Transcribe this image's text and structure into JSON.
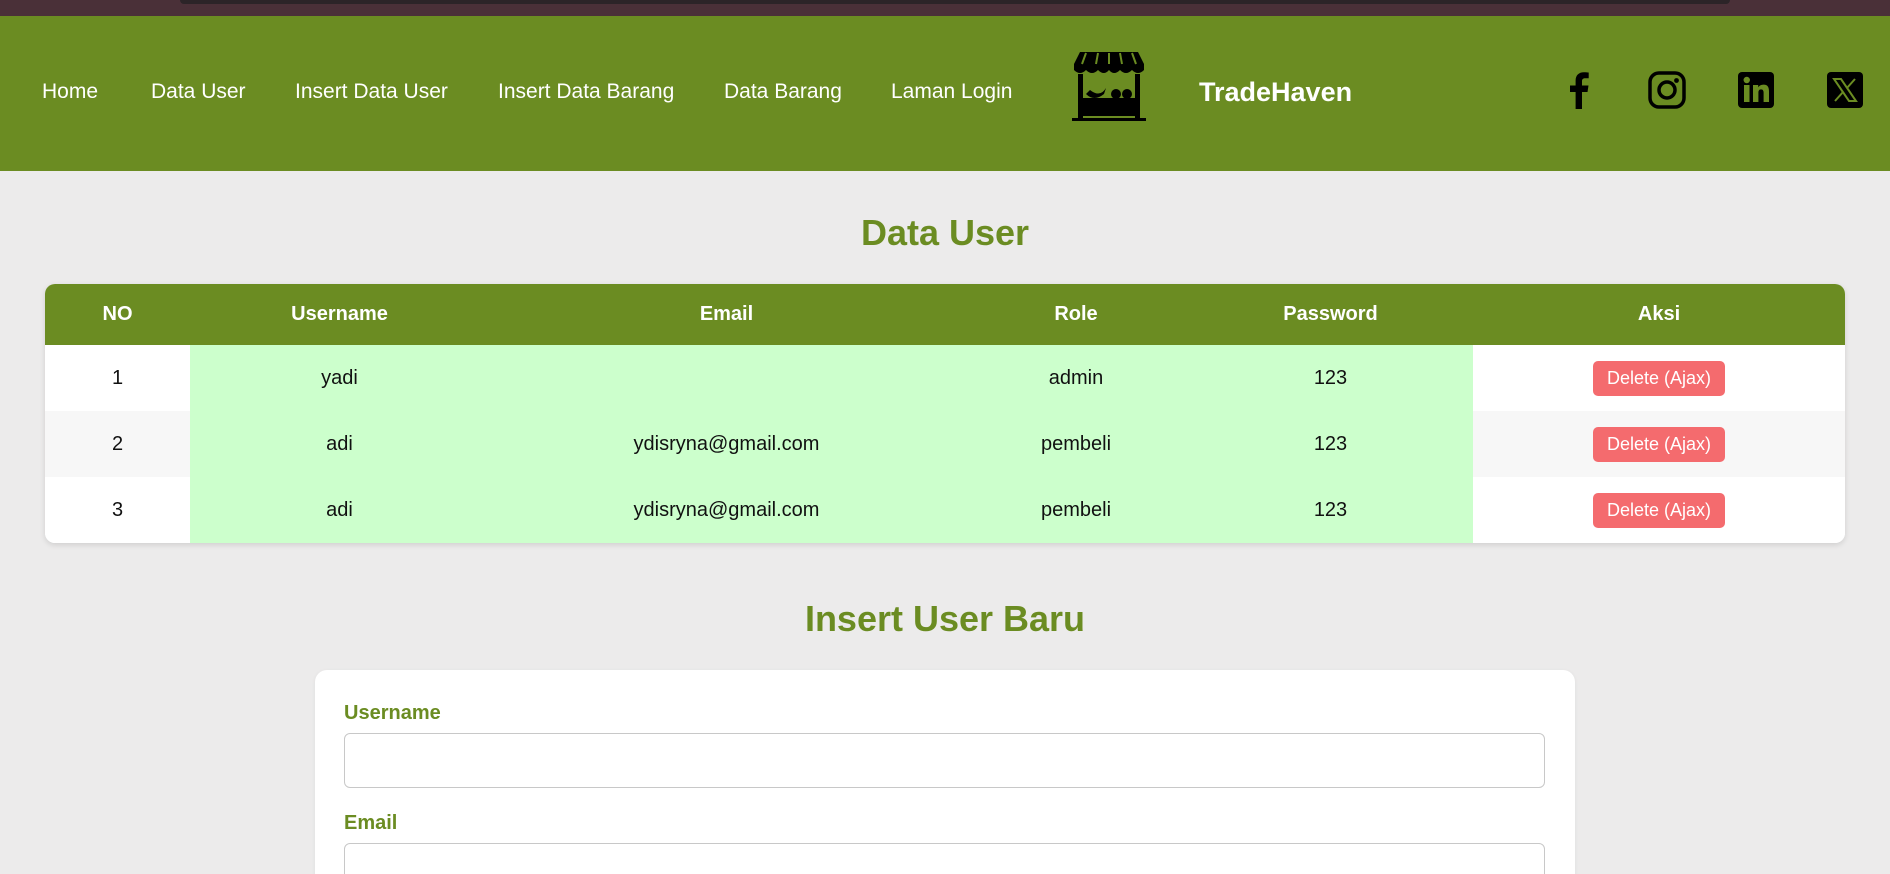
{
  "nav": {
    "items": [
      {
        "label": "Home"
      },
      {
        "label": "Data User"
      },
      {
        "label": "Insert Data User"
      },
      {
        "label": "Insert Data Barang"
      },
      {
        "label": "Data Barang"
      },
      {
        "label": "Laman Login"
      }
    ],
    "brand": "TradeHaven",
    "logo_icon": "market-stall-icon",
    "social_icons": [
      "facebook-icon",
      "instagram-icon",
      "linkedin-icon",
      "x-twitter-icon"
    ]
  },
  "colors": {
    "primary": "#6b8c22",
    "row_highlight": "#ccffcc",
    "danger": "#f46b6e",
    "page_bg": "#ecebeb"
  },
  "data_user": {
    "title": "Data User",
    "columns": [
      "NO",
      "Username",
      "Email",
      "Role",
      "Password",
      "Aksi"
    ],
    "rows": [
      {
        "no": "1",
        "username": "yadi",
        "email": "",
        "role": "admin",
        "password": "123",
        "action": "Delete (Ajax)"
      },
      {
        "no": "2",
        "username": "adi",
        "email": "ydisryna@gmail.com",
        "role": "pembeli",
        "password": "123",
        "action": "Delete (Ajax)"
      },
      {
        "no": "3",
        "username": "adi",
        "email": "ydisryna@gmail.com",
        "role": "pembeli",
        "password": "123",
        "action": "Delete (Ajax)"
      }
    ]
  },
  "insert_user": {
    "title": "Insert User Baru",
    "username_label": "Username",
    "username_value": "",
    "email_label": "Email",
    "email_value": ""
  }
}
